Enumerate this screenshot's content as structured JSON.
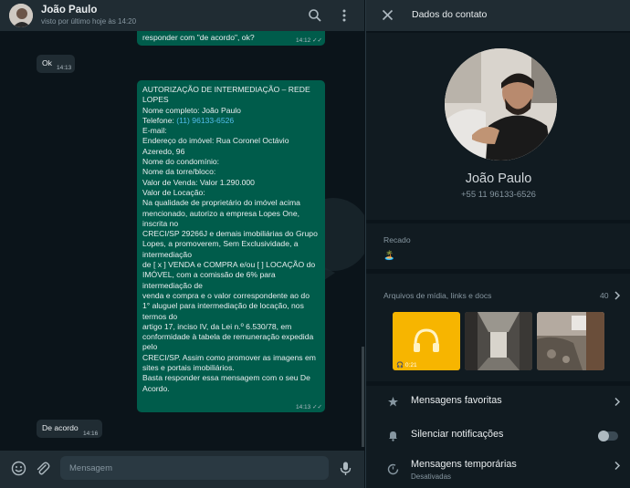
{
  "chat": {
    "header": {
      "name": "João Paulo",
      "status": "visto por último hoje às 14:20"
    },
    "messages": [
      {
        "direction": "out",
        "lines": [
          "responder com \"de acordo\", ok?"
        ],
        "time": "14:12"
      },
      {
        "direction": "in",
        "lines": [
          "Ok"
        ],
        "time": "14:13"
      },
      {
        "direction": "out",
        "lines": [
          "AUTORIZAÇÃO DE INTERMEDIAÇÃO – REDE",
          "LOPES",
          "Nome completo: João Paulo",
          "Telefone: (11) 96133-6526",
          "E-mail:",
          "Endereço do imóvel: Rua Coronel Octávio",
          "Azeredo, 96",
          "Nome do condomínio:",
          "Nome da torre/bloco:",
          "Valor de Venda: Valor 1.290.000",
          "Valor de Locação:",
          "Na qualidade de proprietário do imóvel acima",
          "mencionado, autorizo a empresa Lopes One,",
          "inscrita no",
          "CRECI/SP 29266J e demais imobiliárias do Grupo",
          "Lopes, a promoverem, Sem Exclusividade, a",
          "intermediação",
          "de [ x ] VENDA e COMPRA e/ou [ ] LOCAÇÃO do",
          "IMÓVEL, com a comissão de 6% para",
          "intermediação de",
          "venda e compra e o valor correspondente ao do",
          "1° aluguel para intermediação de locação, nos",
          "termos do",
          "artigo 17, inciso IV, da Lei n.º 6.530/78, em",
          "conformidade à tabela de remuneração expedida",
          "pelo",
          "CRECI/SP. Assim como promover as imagens em",
          "sites e portais imobiliários.",
          "Basta responder essa mensagem com o seu De",
          "Acordo."
        ],
        "phone_label": "Telefone: ",
        "phone_link": "(11) 96133-6526",
        "time": "14:13"
      },
      {
        "direction": "in",
        "lines": [
          "De acordo"
        ],
        "time": "14:16"
      }
    ],
    "composer": {
      "placeholder": "Mensagem"
    }
  },
  "contact_info": {
    "title": "Dados do contato",
    "name": "João Paulo",
    "phone": "+55 11 96133-6526",
    "about_label": "Recado",
    "about_value": "🏝️",
    "media": {
      "label": "Arquivos de mídia, links e docs",
      "count": "40",
      "thumbs": [
        {
          "type": "audio",
          "duration": "0:21"
        },
        {
          "type": "photo"
        },
        {
          "type": "photo"
        }
      ]
    },
    "settings": [
      {
        "label": "Mensagens favoritas",
        "icon": "star-icon"
      },
      {
        "label": "Silenciar notificações",
        "icon": "bell-icon",
        "toggle": false
      },
      {
        "label": "Mensagens temporárias",
        "sub": "Desativadas",
        "icon": "timer-icon"
      }
    ]
  },
  "colors": {
    "background": "#0b141a",
    "panel": "#111b21",
    "header": "#202c33",
    "outgoing_bubble": "#005c4b",
    "incoming_bubble": "#202c33",
    "link": "#53bdeb",
    "audio_thumb": "#f7b500"
  }
}
